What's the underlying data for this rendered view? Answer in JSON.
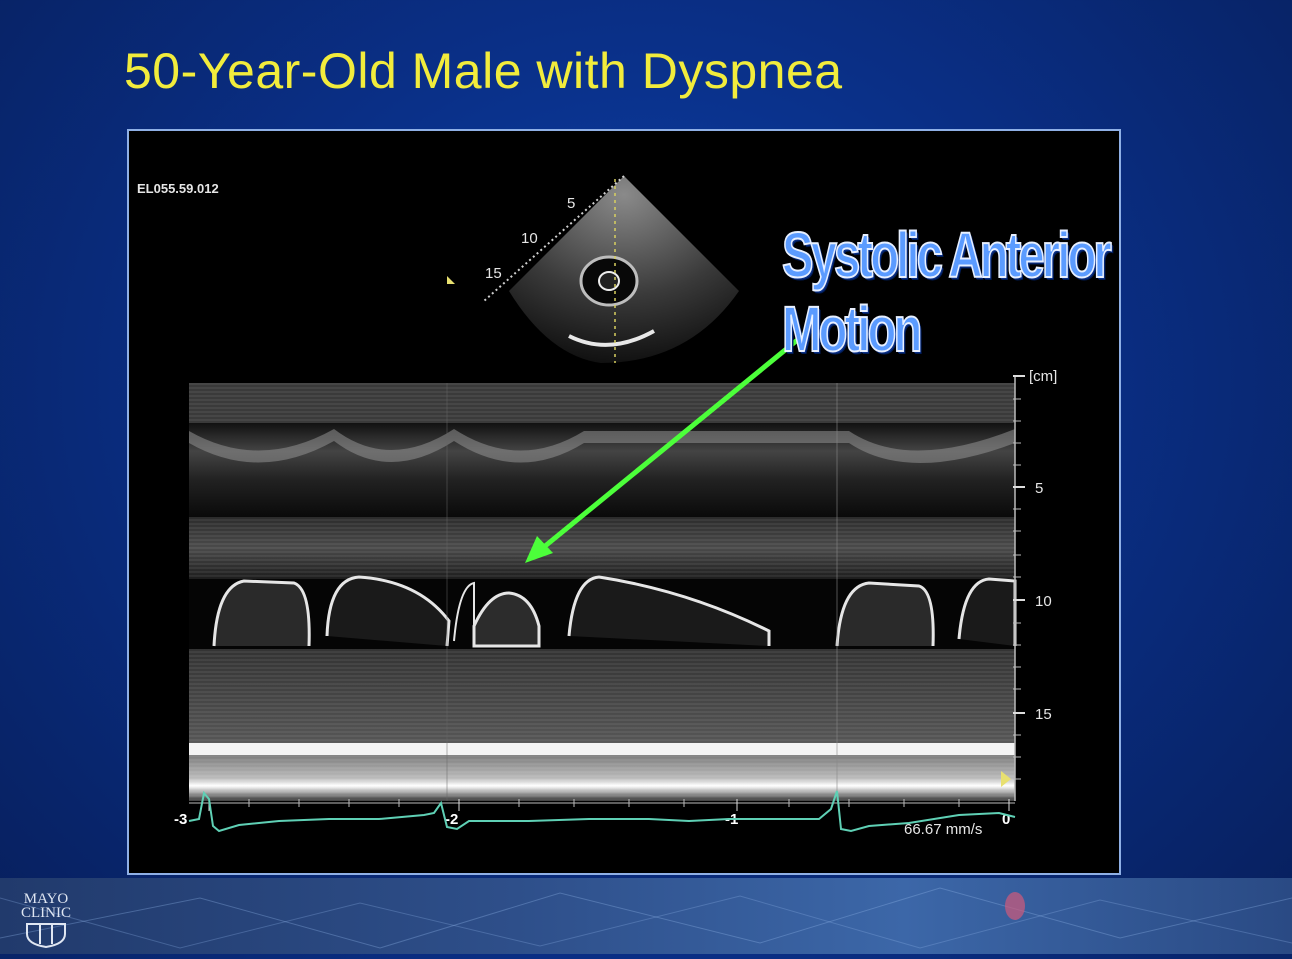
{
  "slide": {
    "title": "50-Year-Old Male with Dyspnea",
    "annotation": "Systolic Anterior Motion"
  },
  "echo": {
    "study_id": "EL055.59.012",
    "sector_depth_labels": [
      "5",
      "10",
      "15"
    ],
    "depth_unit": "[cm]",
    "depth_ticks": [
      "5",
      "10",
      "15"
    ],
    "time_ticks": [
      "-3",
      "-2",
      "-1",
      "0"
    ],
    "sweep_speed": "66.67 mm/s"
  },
  "colors": {
    "title": "#f2ec3c",
    "annotation": "#5b9bff",
    "arrow": "#4cff3a",
    "ecg": "#5fd0b5"
  },
  "footer": {
    "logo_line1": "MAYO",
    "logo_line2": "CLINIC"
  }
}
